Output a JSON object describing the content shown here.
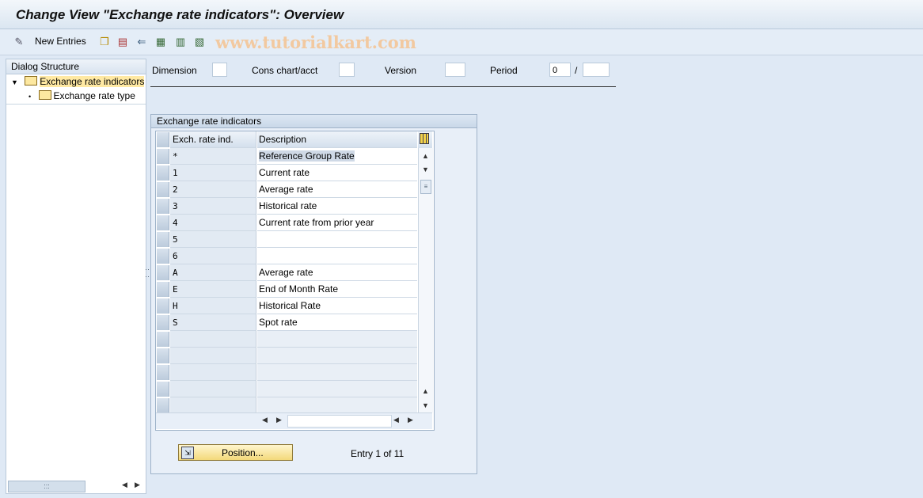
{
  "window": {
    "title": "Change View \"Exchange rate indicators\": Overview"
  },
  "toolbar": {
    "new_entries_label": "New Entries",
    "icons": [
      "edit-glasses-icon",
      "copy-icon",
      "delete-icon",
      "undo-icon",
      "select-all-icon",
      "select-block-icon",
      "deselect-all-icon"
    ],
    "watermark": "www.tutorialkart.com"
  },
  "sidebar": {
    "header": "Dialog Structure",
    "items": [
      {
        "label": "Exchange rate indicators",
        "selected": true
      },
      {
        "label": "Exchange rate type",
        "selected": false
      }
    ]
  },
  "header_fields": {
    "dimension": {
      "label": "Dimension",
      "value": ""
    },
    "cons_chart": {
      "label": "Cons chart/acct",
      "value": ""
    },
    "version": {
      "label": "Version",
      "value": ""
    },
    "period": {
      "label": "Period",
      "value": "0",
      "separator": "/",
      "year": ""
    }
  },
  "table": {
    "group_title": "Exchange rate indicators",
    "columns": [
      "Exch. rate ind.",
      "Description"
    ],
    "rows": [
      {
        "ind": "*",
        "desc": "Reference Group Rate"
      },
      {
        "ind": "1",
        "desc": "Current rate"
      },
      {
        "ind": "2",
        "desc": "Average rate"
      },
      {
        "ind": "3",
        "desc": "Historical rate"
      },
      {
        "ind": "4",
        "desc": "Current rate from prior year"
      },
      {
        "ind": "5",
        "desc": ""
      },
      {
        "ind": "6",
        "desc": ""
      },
      {
        "ind": "A",
        "desc": "Average rate"
      },
      {
        "ind": "E",
        "desc": "End of Month Rate"
      },
      {
        "ind": "H",
        "desc": "Historical Rate"
      },
      {
        "ind": "S",
        "desc": "Spot rate"
      }
    ]
  },
  "footer": {
    "position_label": "Position...",
    "entry_text": "Entry 1 of 11"
  }
}
